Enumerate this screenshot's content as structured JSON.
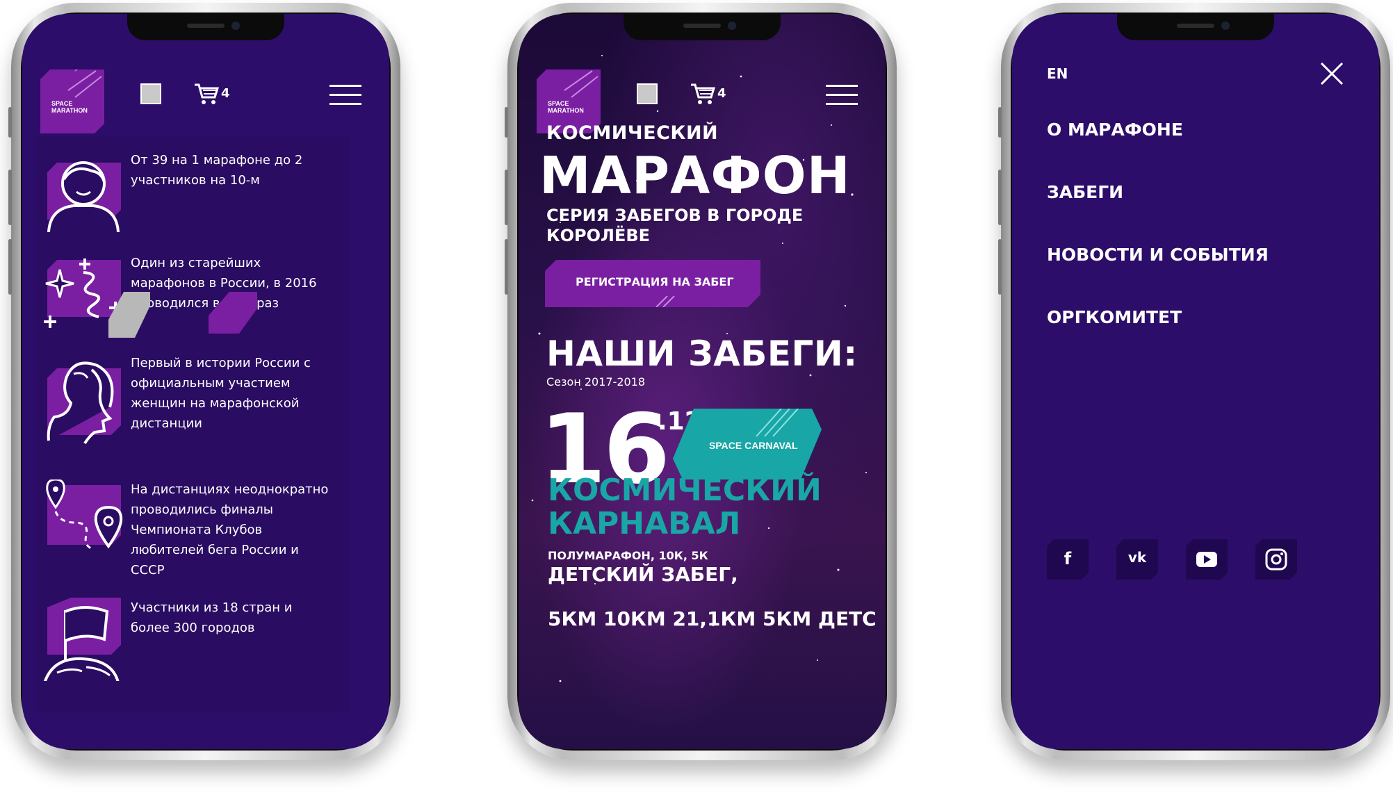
{
  "header": {
    "cart_count": "4",
    "logo_text": "SPACE MARATHON"
  },
  "screen1": {
    "features": [
      {
        "icon": "person-icon",
        "text": "От 39 на 1 марафоне до 2 участников на 10-м"
      },
      {
        "icon": "sparkles-icon",
        "text": "Один из старейших марафонов в России, в 2016 проводился в 40-й раз"
      },
      {
        "icon": "woman-profile-icon",
        "text": "Первый в истории России с официальным участием женщин на марафонской дистанции"
      },
      {
        "icon": "route-pins-icon",
        "text": "На дистанциях неоднократно проводились финалы Чемпионата Клубов любителей бега России и СССР"
      },
      {
        "icon": "flag-globe-icon",
        "text": "Участники из 18 стран и более 300 городов"
      }
    ]
  },
  "screen2": {
    "subtitle": "КОСМИЧЕСКИЙ",
    "title": "МАРАФОН",
    "tagline": "СЕРИЯ ЗАБЕГОВ В ГОРОДЕ КОРОЛЁВЕ",
    "register_label": "РЕГИСТРАЦИЯ НА ЗАБЕГ",
    "races_heading": "НАШИ ЗАБЕГИ:",
    "season": "Сезон 2017-2018",
    "event_day": "16",
    "event_month": ".12",
    "badge_text": "SPACE CARNAVAL",
    "event_name": "КОСМИЧЕСКИЙ КАРНАВАЛ",
    "distances": "ПОЛУМАРАФОН, 10К, 5К",
    "kids_run": "ДЕТСКИЙ ЗАБЕГ,",
    "cut_text": "5КМ 10КМ 21,1КМ 5КМ ДЕТС"
  },
  "screen3": {
    "lang": "EN",
    "menu": [
      "О МАРАФОНЕ",
      "ЗАБЕГИ",
      "НОВОСТИ И СОБЫТИЯ",
      "ОРГКОМИТЕТ"
    ],
    "socials": [
      "facebook-icon",
      "vk-icon",
      "youtube-icon",
      "instagram-icon"
    ]
  },
  "colors": {
    "bg": "#2d0d6a",
    "accent": "#7b1fa2",
    "teal": "#19a6a6",
    "white": "#ffffff"
  }
}
